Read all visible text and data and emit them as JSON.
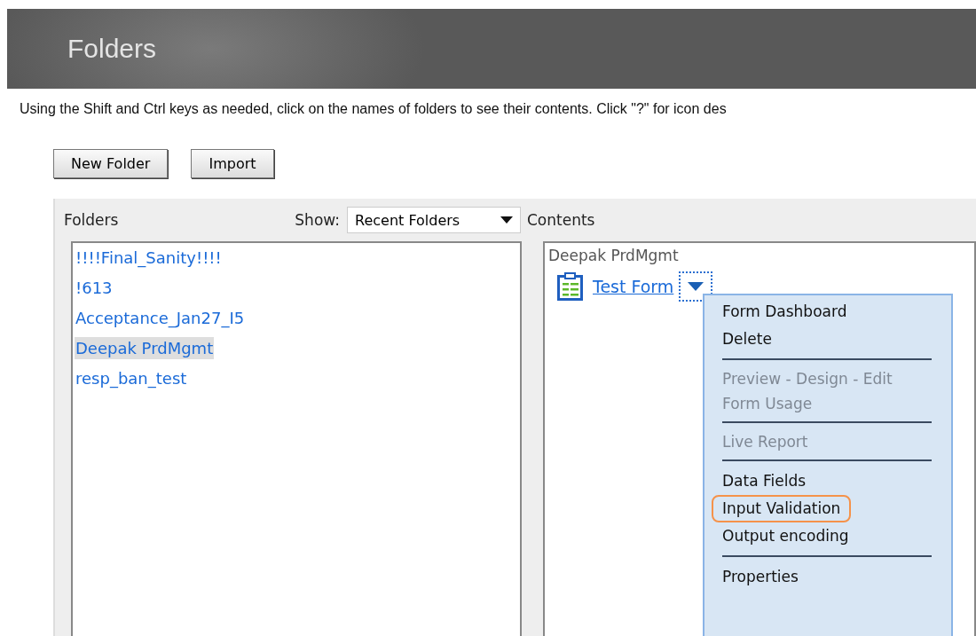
{
  "header": {
    "title": "Folders"
  },
  "instructions": "Using the Shift and Ctrl keys as needed, click on the names of folders to see their contents. Click \"?\" for icon des",
  "buttons": [
    "New Folder",
    "Import"
  ],
  "folders_panel": {
    "title": "Folders",
    "show_label": "Show:",
    "show_value": "Recent Folders",
    "items": [
      {
        "label": "!!!!Final_Sanity!!!!",
        "selected": false
      },
      {
        "label": "!613",
        "selected": false
      },
      {
        "label": "Acceptance_Jan27_I5",
        "selected": false
      },
      {
        "label": "Deepak PrdMgmt",
        "selected": true
      },
      {
        "label": "resp_ban_test",
        "selected": false
      }
    ]
  },
  "contents_panel": {
    "title": "Contents",
    "folder": "Deepak PrdMgmt",
    "item": {
      "label": "Test Form",
      "menu_open": true
    },
    "menu": [
      {
        "kind": "item",
        "label": "Form Dashboard",
        "disabled": false,
        "selected": false
      },
      {
        "kind": "item",
        "label": "Delete",
        "disabled": false,
        "selected": false
      },
      {
        "kind": "separator"
      },
      {
        "kind": "item",
        "label": "Preview - Design - Edit",
        "disabled": true,
        "selected": false
      },
      {
        "kind": "item",
        "label": "Form Usage",
        "disabled": true,
        "selected": false
      },
      {
        "kind": "separator"
      },
      {
        "kind": "item",
        "label": "Live Report",
        "disabled": true,
        "selected": false
      },
      {
        "kind": "separator"
      },
      {
        "kind": "item",
        "label": "Data Fields",
        "disabled": false,
        "selected": false
      },
      {
        "kind": "item",
        "label": "Input Validation",
        "disabled": false,
        "selected": true
      },
      {
        "kind": "item",
        "label": "Output encoding",
        "disabled": false,
        "selected": false
      },
      {
        "kind": "separator"
      },
      {
        "kind": "item",
        "label": "Properties",
        "disabled": false,
        "selected": false
      }
    ]
  }
}
